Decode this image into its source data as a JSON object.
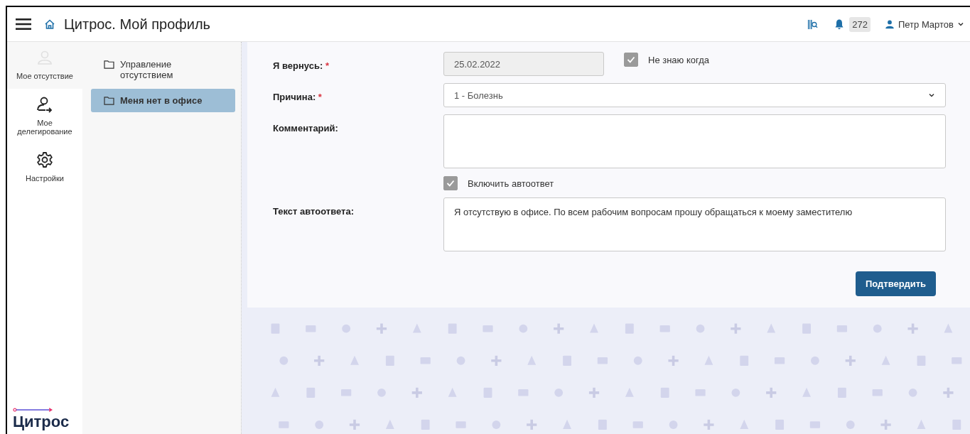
{
  "header": {
    "title": "Цитрос. Мой профиль",
    "notifications": "272",
    "user": "Петр Мартов"
  },
  "rail": [
    {
      "label": "Мое отсутствие",
      "kind": "person",
      "selected": true
    },
    {
      "label": "Мое делегирование",
      "kind": "delegate",
      "selected": false
    },
    {
      "label": "Настройки",
      "kind": "gear",
      "selected": false
    }
  ],
  "logo": "Цитрос",
  "sidebar": [
    {
      "label": "Управление отсутствием",
      "selected": false
    },
    {
      "label": "Меня нет в офисе",
      "selected": true
    }
  ],
  "form": [
    {
      "kind": "date",
      "label": "Я вернусь:",
      "required_mark": "*",
      "value": "25.02.2022",
      "disabled": true,
      "option": {
        "label": "Не знаю когда",
        "checked": true
      }
    },
    {
      "kind": "select",
      "label": "Причина:",
      "required_mark": "*",
      "value": "1 - Болезнь"
    },
    {
      "kind": "textarea",
      "label": "Комментарий:"
    },
    {
      "kind": "checkbox",
      "label": "Включить автоответ",
      "checked": true
    },
    {
      "kind": "textarea",
      "label": "Текст автоответа:",
      "value": "Я отсутствую в офисе. По всем рабочим вопросам прошу обращаться к моему заместителю"
    }
  ],
  "submit": "Подтвердить"
}
